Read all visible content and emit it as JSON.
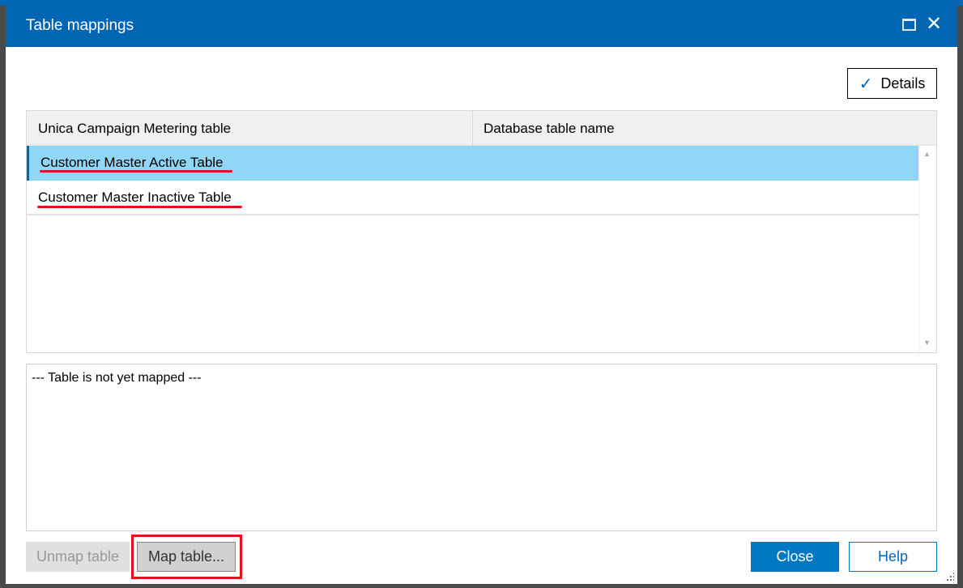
{
  "dialog": {
    "title": "Table mappings"
  },
  "toolbar": {
    "details_label": "Details"
  },
  "grid": {
    "columns": [
      "Unica Campaign Metering table",
      "Database table name"
    ],
    "rows": [
      {
        "metering_table": "Customer Master Active Table",
        "database_table": "",
        "selected": true
      },
      {
        "metering_table": "Customer Master Inactive Table",
        "database_table": "",
        "selected": false
      }
    ]
  },
  "info": {
    "text": "--- Table is not yet mapped ---"
  },
  "footer": {
    "unmap_label": "Unmap table",
    "map_label": "Map table...",
    "close_label": "Close",
    "help_label": "Help"
  },
  "colors": {
    "accent": "#0066b3",
    "selected_row": "#8fd6f7",
    "highlight": "#e0141e"
  }
}
